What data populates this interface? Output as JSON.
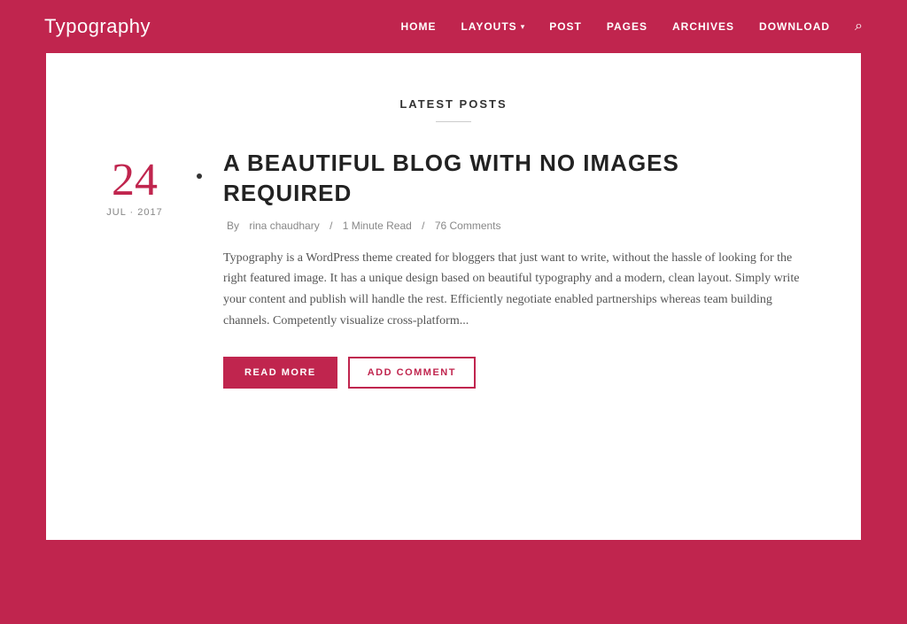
{
  "site": {
    "logo": "Typography"
  },
  "nav": {
    "items": [
      {
        "label": "HOME",
        "id": "home"
      },
      {
        "label": "LAYOUTS",
        "id": "layouts",
        "hasDropdown": true
      },
      {
        "label": "POST",
        "id": "post"
      },
      {
        "label": "PAGES",
        "id": "pages"
      },
      {
        "label": "ARCHIVES",
        "id": "archives"
      },
      {
        "label": "DOWNLOAD",
        "id": "download"
      }
    ]
  },
  "main": {
    "section_title": "LATEST POSTS",
    "post": {
      "date_number": "24",
      "date_month_year": "JUL · 2017",
      "title": "A BEAUTIFUL BLOG WITH NO IMAGES REQUIRED",
      "author": "rina chaudhary",
      "read_time": "1 Minute Read",
      "comments_count": "76 Comments",
      "excerpt": "Typography is a WordPress theme created for bloggers that just want to write, without the hassle of looking for the right featured image. It has a unique design based on beautiful typography and a modern, clean layout. Simply write your content and publish will handle the rest. Efficiently negotiate enabled partnerships whereas team building channels. Competently visualize cross-platform...",
      "btn_read_more": "READ MORE",
      "btn_add_comment": "ADD COMMENT"
    }
  }
}
